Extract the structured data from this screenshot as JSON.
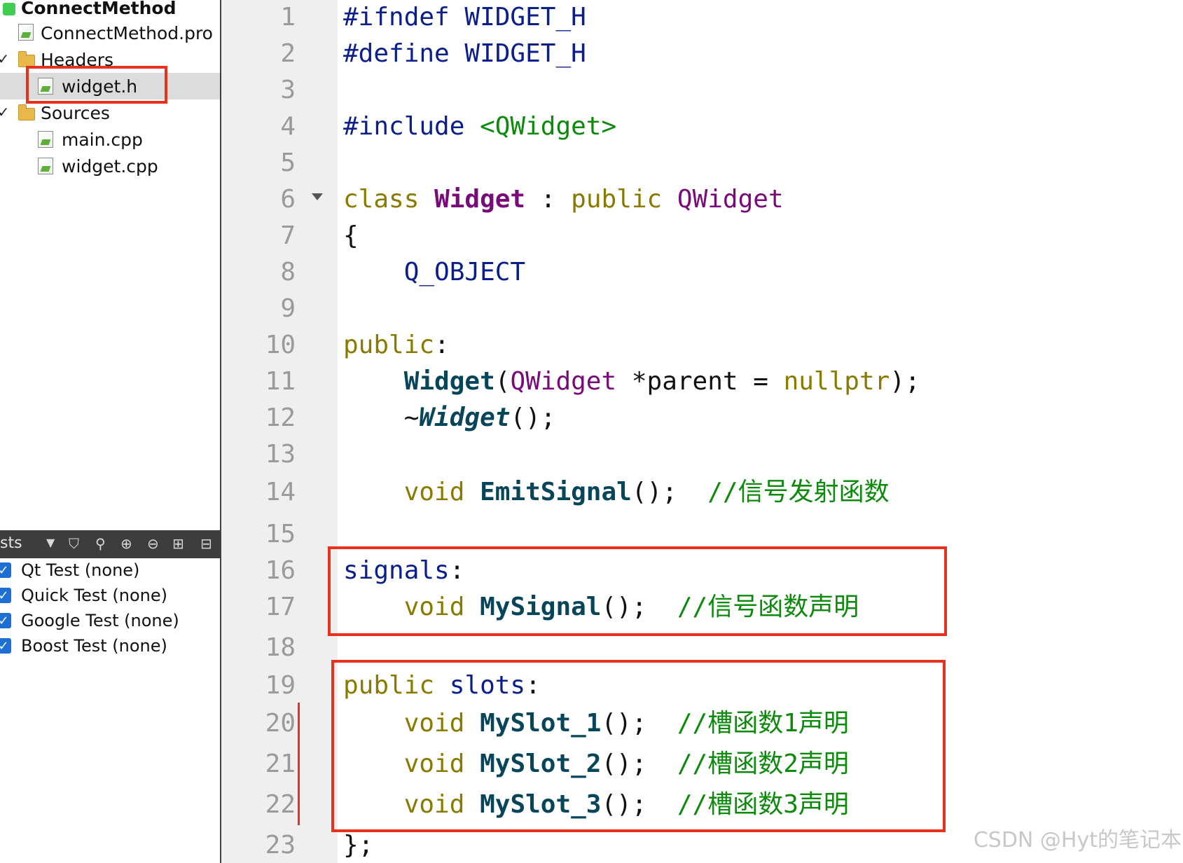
{
  "project_tree": {
    "project_name": "ConnectMethod",
    "pro_file": "ConnectMethod.pro",
    "headers_label": "Headers",
    "header_files": [
      "widget.h"
    ],
    "sources_label": "Sources",
    "source_files": [
      "main.cpp",
      "widget.cpp"
    ],
    "selected": "widget.h"
  },
  "tests_panel": {
    "title": "sts",
    "items": [
      "Qt Test (none)",
      "Quick Test (none)",
      "Google Test (none)",
      "Boost Test (none)"
    ]
  },
  "editor": {
    "line_numbers": [
      "1",
      "2",
      "3",
      "4",
      "5",
      "6",
      "7",
      "8",
      "9",
      "10",
      "11",
      "12",
      "13",
      "14",
      "15",
      "16",
      "17",
      "18",
      "19",
      "20",
      "21",
      "22",
      "23"
    ],
    "code": {
      "l1_a": "#ifndef",
      "l1_b": "WIDGET_H",
      "l2_a": "#define",
      "l2_b": "WIDGET_H",
      "l4_a": "#include",
      "l4_b": "<QWidget>",
      "l6_a": "class",
      "l6_b": "Widget",
      "l6_c": ":",
      "l6_d": "public",
      "l6_e": "QWidget",
      "l7": "{",
      "l8": "Q_OBJECT",
      "l10_a": "public",
      "l10_b": ":",
      "l11_a": "Widget",
      "l11_b": "(",
      "l11_c": "QWidget",
      "l11_d": "*parent =",
      "l11_e": "nullptr",
      "l11_f": ");",
      "l12_a": "~",
      "l12_b": "Widget",
      "l12_c": "();",
      "l14_a": "void",
      "l14_b": "EmitSignal",
      "l14_c": "();",
      "l14_d": "//信号发射函数",
      "l16_a": "signals",
      "l16_b": ":",
      "l17_a": "void",
      "l17_b": "MySignal",
      "l17_c": "();",
      "l17_d": "//信号函数声明",
      "l19_a": "public",
      "l19_b": "slots",
      "l19_c": ":",
      "l20_a": "void",
      "l20_b": "MySlot_1",
      "l20_c": "();",
      "l20_d": "//槽函数1声明",
      "l21_a": "void",
      "l21_b": "MySlot_2",
      "l21_c": "();",
      "l21_d": "//槽函数2声明",
      "l22_a": "void",
      "l22_b": "MySlot_3",
      "l22_c": "();",
      "l22_d": "//槽函数3声明",
      "l23": "};"
    }
  },
  "watermark": "CSDN @Hyt的笔记本",
  "colors": {
    "highlight_box": "#e8321e",
    "preprocessor": "#0a1e8c",
    "keyword": "#8a7a00",
    "comment": "#0b8a0b",
    "function": "#07465a",
    "type": "#7a0a7a"
  }
}
